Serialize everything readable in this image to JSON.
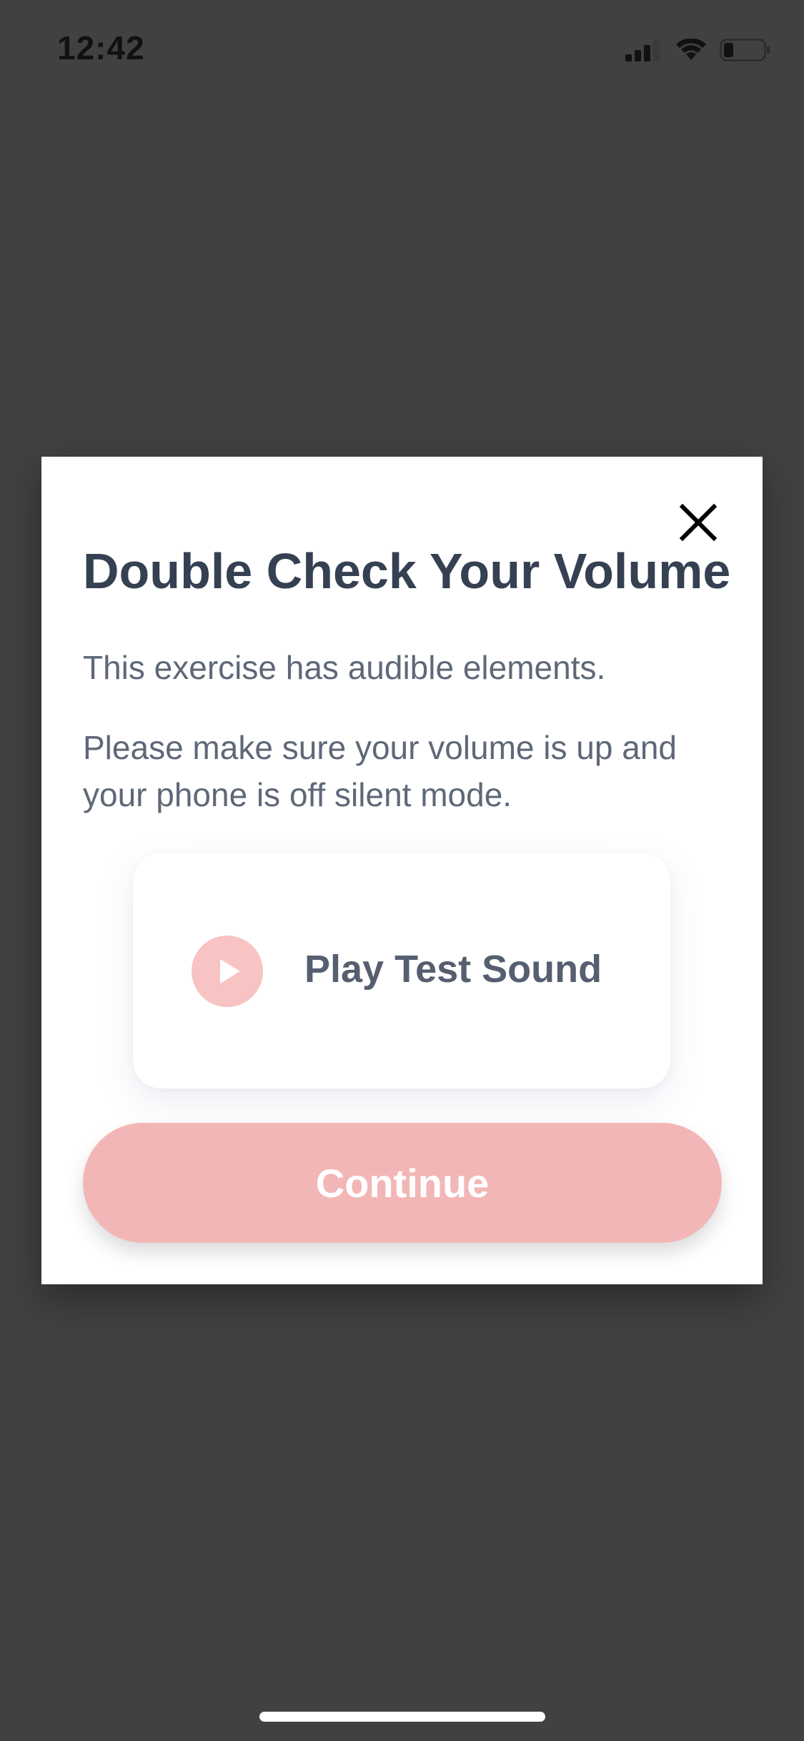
{
  "status_bar": {
    "time": "12:42",
    "icons": [
      "cellular-signal-icon",
      "wifi-icon",
      "battery-icon"
    ]
  },
  "modal": {
    "title": "Double Check Your Volume",
    "paragraph_1": "This exercise has audible elements.",
    "paragraph_2": "Please make sure your volume is up and your phone is off silent mode.",
    "close_icon": "close-icon",
    "test_sound": {
      "icon": "play-icon",
      "label": "Play Test Sound"
    },
    "continue_label": "Continue"
  },
  "colors": {
    "backdrop": "#414141",
    "title": "#354052",
    "body_text": "#5f6878",
    "accent_pink": "#f3b6b6",
    "play_circle": "#f8c3c3",
    "white": "#ffffff"
  }
}
